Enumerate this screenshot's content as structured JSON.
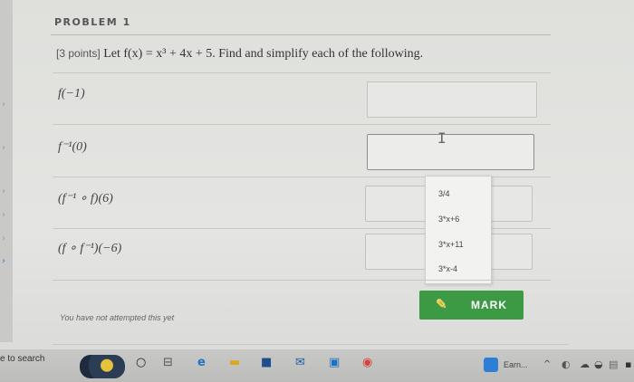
{
  "problem": {
    "title": "PROBLEM 1",
    "points": "[3 points]",
    "statement": "Let f(x) = x³ + 4x + 5. Find and simplify each of the following."
  },
  "rows": [
    {
      "expr": "f(−1)"
    },
    {
      "expr": "f⁻¹(0)"
    },
    {
      "expr": "(f⁻¹ ∘ f)(6)"
    },
    {
      "expr": "(f ∘ f⁻¹)(−6)"
    }
  ],
  "dropdown": {
    "options": [
      "3/4",
      "3*x+6",
      "3*x+11",
      "3*x-4"
    ]
  },
  "mark_button": {
    "label": "MARK"
  },
  "status_text": "You have not attempted this yet",
  "taskbar": {
    "search_text": "e to search",
    "earn_label": "Earn..."
  },
  "icons": {
    "pencil": "pencil-icon",
    "text_cursor": "i-beam-cursor-icon"
  }
}
